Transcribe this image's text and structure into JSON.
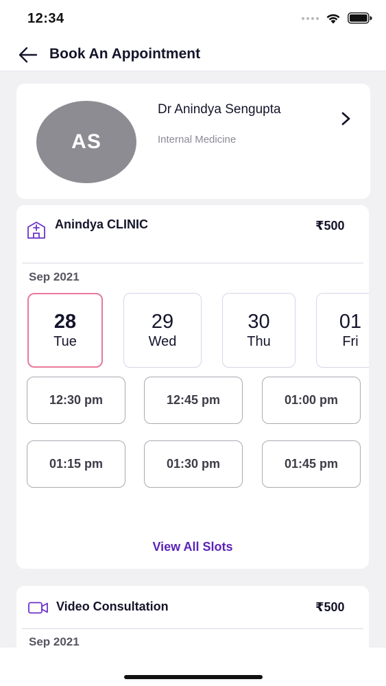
{
  "status_bar": {
    "time": "12:34"
  },
  "header": {
    "title": "Book An Appointment"
  },
  "doctor": {
    "initials": "AS",
    "name": "Dr Anindya Sengupta",
    "specialty": "Internal Medicine"
  },
  "clinic": {
    "name": "Anindya CLINIC",
    "fee": "₹500",
    "month": "Sep 2021",
    "dates": [
      {
        "num": "28",
        "day": "Tue",
        "selected": true
      },
      {
        "num": "29",
        "day": "Wed",
        "selected": false
      },
      {
        "num": "30",
        "day": "Thu",
        "selected": false
      },
      {
        "num": "01",
        "day": "Fri",
        "selected": false
      }
    ],
    "slots": [
      "12:30 pm",
      "12:45 pm",
      "01:00 pm",
      "01:15 pm",
      "01:30 pm",
      "01:45 pm"
    ],
    "view_all": "View All Slots"
  },
  "video": {
    "name": "Video Consultation",
    "fee": "₹500",
    "month": "Sep 2021"
  },
  "colors": {
    "accent": "#5a23b6",
    "selected_border": "#e8789a",
    "avatar_bg": "#8e8c93"
  }
}
